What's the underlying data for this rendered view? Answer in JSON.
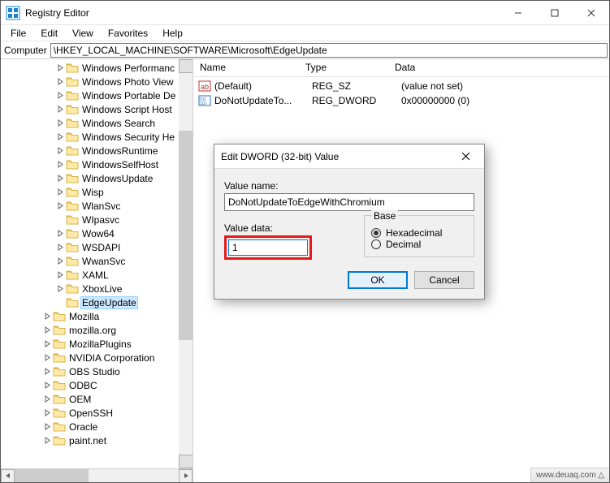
{
  "window": {
    "title": "Registry Editor",
    "minimize_glyph": "—",
    "maximize_glyph": "▢",
    "close_glyph": "✕"
  },
  "menu": {
    "items": [
      "File",
      "Edit",
      "View",
      "Favorites",
      "Help"
    ]
  },
  "address": {
    "label": "Computer",
    "path": "\\HKEY_LOCAL_MACHINE\\SOFTWARE\\Microsoft\\EdgeUpdate"
  },
  "tree": {
    "items": [
      {
        "indent": 4,
        "tw": "right",
        "label": "Windows Performanc"
      },
      {
        "indent": 4,
        "tw": "right",
        "label": "Windows Photo View"
      },
      {
        "indent": 4,
        "tw": "right",
        "label": "Windows Portable De"
      },
      {
        "indent": 4,
        "tw": "right",
        "label": "Windows Script Host"
      },
      {
        "indent": 4,
        "tw": "right",
        "label": "Windows Search"
      },
      {
        "indent": 4,
        "tw": "right",
        "label": "Windows Security He"
      },
      {
        "indent": 4,
        "tw": "right",
        "label": "WindowsRuntime"
      },
      {
        "indent": 4,
        "tw": "right",
        "label": "WindowsSelfHost"
      },
      {
        "indent": 4,
        "tw": "right",
        "label": "WindowsUpdate"
      },
      {
        "indent": 4,
        "tw": "right",
        "label": "Wisp"
      },
      {
        "indent": 4,
        "tw": "right",
        "label": "WlanSvc"
      },
      {
        "indent": 4,
        "tw": "",
        "label": "WIpasvc"
      },
      {
        "indent": 4,
        "tw": "right",
        "label": "Wow64"
      },
      {
        "indent": 4,
        "tw": "right",
        "label": "WSDAPI"
      },
      {
        "indent": 4,
        "tw": "right",
        "label": "WwanSvc"
      },
      {
        "indent": 4,
        "tw": "right",
        "label": "XAML"
      },
      {
        "indent": 4,
        "tw": "right",
        "label": "XboxLive"
      },
      {
        "indent": 4,
        "tw": "",
        "label": "EdgeUpdate",
        "selected": true
      },
      {
        "indent": 3,
        "tw": "right",
        "label": "Mozilla"
      },
      {
        "indent": 3,
        "tw": "right",
        "label": "mozilla.org"
      },
      {
        "indent": 3,
        "tw": "right",
        "label": "MozillaPlugins"
      },
      {
        "indent": 3,
        "tw": "right",
        "label": "NVIDIA Corporation"
      },
      {
        "indent": 3,
        "tw": "right",
        "label": "OBS Studio"
      },
      {
        "indent": 3,
        "tw": "right",
        "label": "ODBC"
      },
      {
        "indent": 3,
        "tw": "right",
        "label": "OEM"
      },
      {
        "indent": 3,
        "tw": "right",
        "label": "OpenSSH"
      },
      {
        "indent": 3,
        "tw": "right",
        "label": "Oracle"
      },
      {
        "indent": 3,
        "tw": "right",
        "label": "paint.net"
      }
    ]
  },
  "list": {
    "columns": {
      "name": "Name",
      "type": "Type",
      "data": "Data"
    },
    "rows": [
      {
        "icon": "string",
        "name": "(Default)",
        "type": "REG_SZ",
        "data": "(value not set)"
      },
      {
        "icon": "dword",
        "name": "DoNotUpdateTo...",
        "type": "REG_DWORD",
        "data": "0x00000000 (0)"
      }
    ]
  },
  "dialog": {
    "title": "Edit DWORD (32-bit) Value",
    "name_label": "Value name:",
    "name_value": "DoNotUpdateToEdgeWithChromium",
    "data_label": "Value data:",
    "data_value": "1",
    "base_label": "Base",
    "hex_label": "Hexadecimal",
    "dec_label": "Decimal",
    "ok": "OK",
    "cancel": "Cancel"
  },
  "status": {
    "text": "www.deuaq.com △"
  }
}
